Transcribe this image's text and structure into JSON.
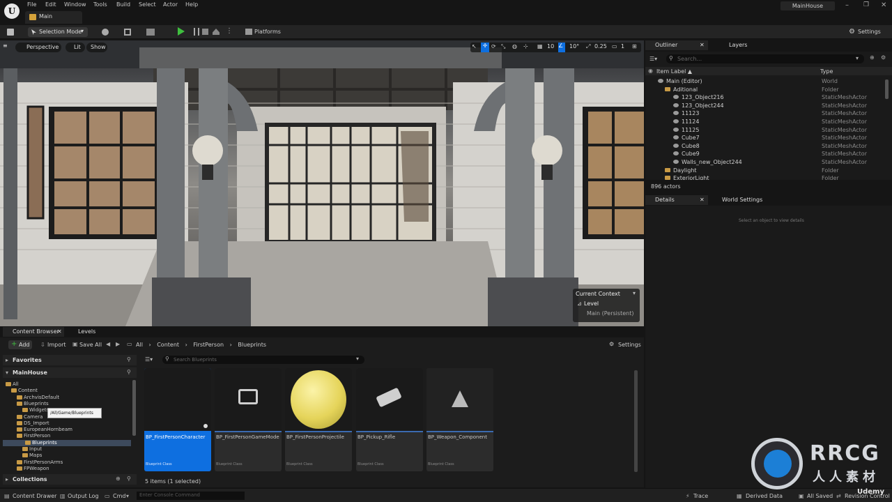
{
  "menubar": {
    "items": [
      "File",
      "Edit",
      "Window",
      "Tools",
      "Build",
      "Select",
      "Actor",
      "Help"
    ],
    "project_name": "MainHouse",
    "tab_label": "Main"
  },
  "toolbar": {
    "selection_mode": "Selection Mode",
    "platforms": "Platforms",
    "settings": "Settings"
  },
  "viewport": {
    "perspective": "Perspective",
    "lit": "Lit",
    "show": "Show",
    "grid_snap": "10",
    "rotation_snap": "10°",
    "scale_snap": "0.25",
    "camera_speed": "1",
    "context": {
      "title": "Current Context",
      "level_label": "Level",
      "level_value": "Main (Persistent)"
    }
  },
  "outliner": {
    "tab_outliner": "Outliner",
    "tab_layers": "Layers",
    "search_placeholder": "Search...",
    "col_label": "Item Label ▲",
    "col_type": "Type",
    "rows": [
      {
        "label": "Main (Editor)",
        "type": "World"
      },
      {
        "label": "Aditional",
        "type": "Folder"
      },
      {
        "label": "123_Object216",
        "type": "StaticMeshActor"
      },
      {
        "label": "123_Object244",
        "type": "StaticMeshActor"
      },
      {
        "label": "11123",
        "type": "StaticMeshActor"
      },
      {
        "label": "11124",
        "type": "StaticMeshActor"
      },
      {
        "label": "11125",
        "type": "StaticMeshActor"
      },
      {
        "label": "Cube7",
        "type": "StaticMeshActor"
      },
      {
        "label": "Cube8",
        "type": "StaticMeshActor"
      },
      {
        "label": "Cube9",
        "type": "StaticMeshActor"
      },
      {
        "label": "Walls_new_Object244",
        "type": "StaticMeshActor"
      },
      {
        "label": "Daylight",
        "type": "Folder"
      },
      {
        "label": "ExteriorLight",
        "type": "Folder"
      }
    ],
    "actor_count": "896 actors"
  },
  "details": {
    "tab_details": "Details",
    "tab_world": "World Settings",
    "empty_msg": "Select an object to view details"
  },
  "content_browser": {
    "tab_cb": "Content Browser",
    "tab_levels": "Levels",
    "add": "Add",
    "import": "Import",
    "save_all": "Save All",
    "breadcrumb": [
      "All",
      "Content",
      "FirstPerson",
      "Blueprints"
    ],
    "settings": "Settings",
    "favorites": "Favorites",
    "project": "MainHouse",
    "search_placeholder": "Search Blueprints",
    "tree": [
      {
        "label": "All",
        "indent": 0
      },
      {
        "label": "Content",
        "indent": 1
      },
      {
        "label": "ArchvisDefault",
        "indent": 2
      },
      {
        "label": "Blueprints",
        "indent": 2
      },
      {
        "label": "Widgets",
        "indent": 3
      },
      {
        "label": "Camera",
        "indent": 2
      },
      {
        "label": "DS_Import",
        "indent": 2
      },
      {
        "label": "EuropeanHornbeam",
        "indent": 2
      },
      {
        "label": "FirstPerson",
        "indent": 2
      },
      {
        "label": "Blueprints",
        "indent": 3
      },
      {
        "label": "Input",
        "indent": 3
      },
      {
        "label": "Maps",
        "indent": 3
      },
      {
        "label": "FirstPersonArms",
        "indent": 2
      },
      {
        "label": "FPWeapon",
        "indent": 2
      }
    ],
    "tooltip": "/All/Game/Blueprints",
    "collections": "Collections",
    "assets": [
      {
        "name": "BP_FirstPersonCharacter",
        "class": "Blueprint Class"
      },
      {
        "name": "BP_FirstPersonGameMode",
        "class": "Blueprint Class"
      },
      {
        "name": "BP_FirstPersonProjectile",
        "class": "Blueprint Class"
      },
      {
        "name": "BP_Pickup_Rifle",
        "class": "Blueprint Class"
      },
      {
        "name": "BP_Weapon_Component",
        "class": "Blueprint Class"
      }
    ],
    "item_count": "5 items (1 selected)"
  },
  "statusbar": {
    "content_drawer": "Content Drawer",
    "output_log": "Output Log",
    "cmd": "Cmd",
    "console_placeholder": "Enter Console Command",
    "trace": "Trace",
    "derived_data": "Derived Data",
    "all_saved": "All Saved",
    "revision_control": "Revision Control"
  },
  "watermark": {
    "brand": "RRCG",
    "sub": "人人素材",
    "udemy": "Udemy"
  },
  "colors": {
    "accent": "#0e6fe0",
    "play": "#3fbf3f",
    "folder": "#c89a45"
  }
}
